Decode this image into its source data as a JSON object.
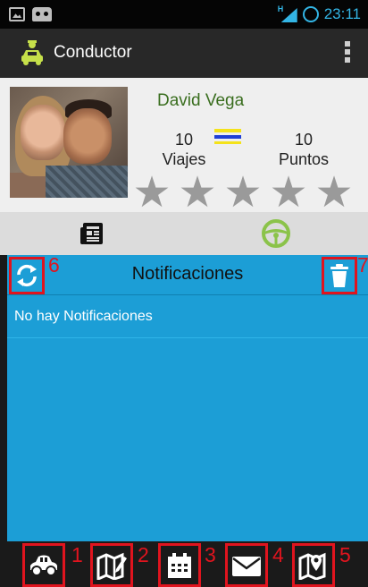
{
  "status_bar": {
    "time": "23:11",
    "network_label": "H"
  },
  "action_bar": {
    "title": "Conductor"
  },
  "profile": {
    "name": "David Vega",
    "trips_value": "10",
    "trips_label": "Viajes",
    "points_value": "10",
    "points_label": "Puntos",
    "rating_stars_filled": 0,
    "rating_stars_total": 5
  },
  "tabs": [
    {
      "icon": "newspaper-icon"
    },
    {
      "icon": "steering-wheel-icon"
    }
  ],
  "notifications": {
    "title": "Notificaciones",
    "empty_message": "No hay Notificaciones",
    "refresh_label": "6",
    "delete_label": "7"
  },
  "bottom_nav": [
    {
      "icon": "car-icon",
      "label": "1"
    },
    {
      "icon": "map-edit-icon",
      "label": "2"
    },
    {
      "icon": "calendar-icon",
      "label": "3"
    },
    {
      "icon": "mail-icon",
      "label": "4"
    },
    {
      "icon": "map-pin-icon",
      "label": "5"
    }
  ],
  "colors": {
    "panel": "#1c9ed6",
    "highlight": "#e0141e",
    "name_text": "#3a6e1f",
    "steering_wheel": "#8bc34a"
  }
}
